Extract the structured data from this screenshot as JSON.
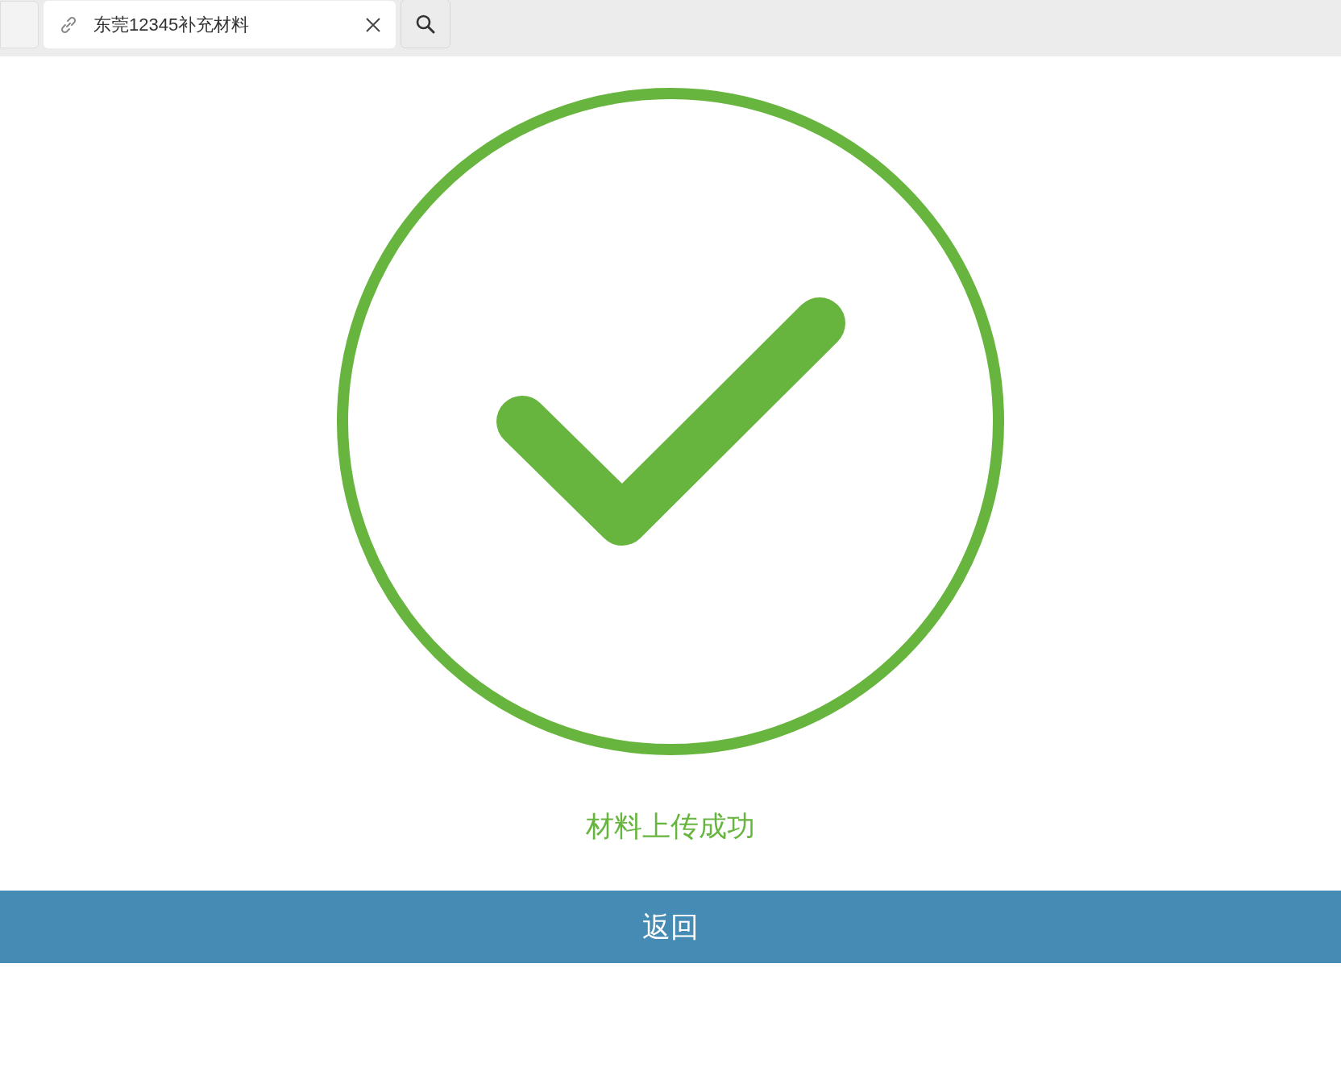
{
  "tabs": [
    {
      "title": "东莞12345补充材料",
      "selected": true
    }
  ],
  "result": {
    "message": "材料上传成功"
  },
  "back_button": {
    "label": "返回"
  }
}
